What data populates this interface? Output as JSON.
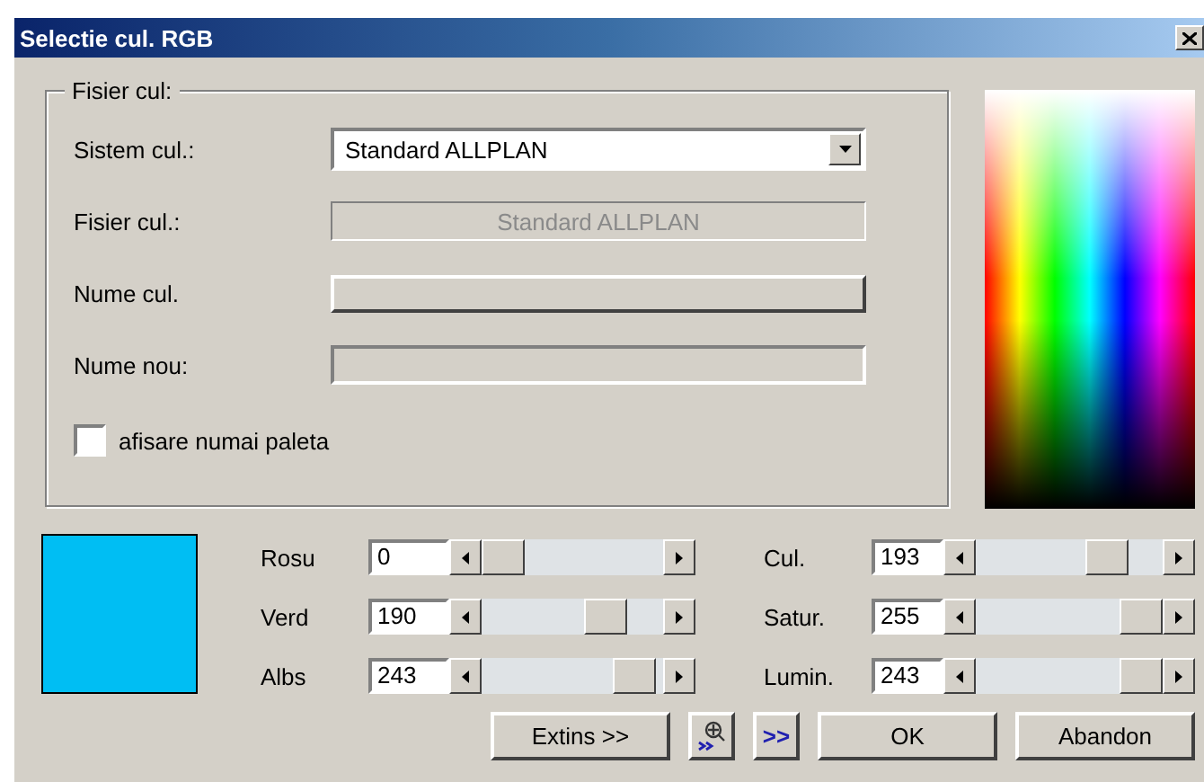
{
  "window": {
    "title": "Selectie cul. RGB"
  },
  "file_group": {
    "title": "Fisier cul:",
    "fields": [
      {
        "kind": "dropdown",
        "label": "Sistem cul.:",
        "value": "Standard ALLPLAN"
      },
      {
        "kind": "readonly",
        "label": "Fisier cul.:",
        "value": "Standard ALLPLAN"
      },
      {
        "kind": "button",
        "label": "Nume cul."
      },
      {
        "kind": "input",
        "label": "Nume nou:"
      }
    ],
    "checkbox": {
      "label": "afisare numai paleta",
      "checked": false
    }
  },
  "swatch": {
    "color": "#00bef3"
  },
  "sliders_left": [
    {
      "label": "Rosu",
      "value": "0",
      "level": 0
    },
    {
      "label": "Verd",
      "value": "190",
      "level": 0.745
    },
    {
      "label": "Albs",
      "value": "243",
      "level": 0.95
    }
  ],
  "sliders_right": [
    {
      "label": "Cul.",
      "value": "193",
      "level": 0.76
    },
    {
      "label": "Satur.",
      "value": "255",
      "level": 1
    },
    {
      "label": "Lumin.",
      "value": "243",
      "level": 1
    }
  ],
  "buttons": [
    {
      "kind": "text",
      "label": "Extins >>"
    },
    {
      "kind": "icon"
    },
    {
      "kind": "glyph",
      "label": ">>"
    },
    {
      "kind": "text",
      "label": "OK"
    },
    {
      "kind": "text",
      "label": "Abandon"
    }
  ]
}
